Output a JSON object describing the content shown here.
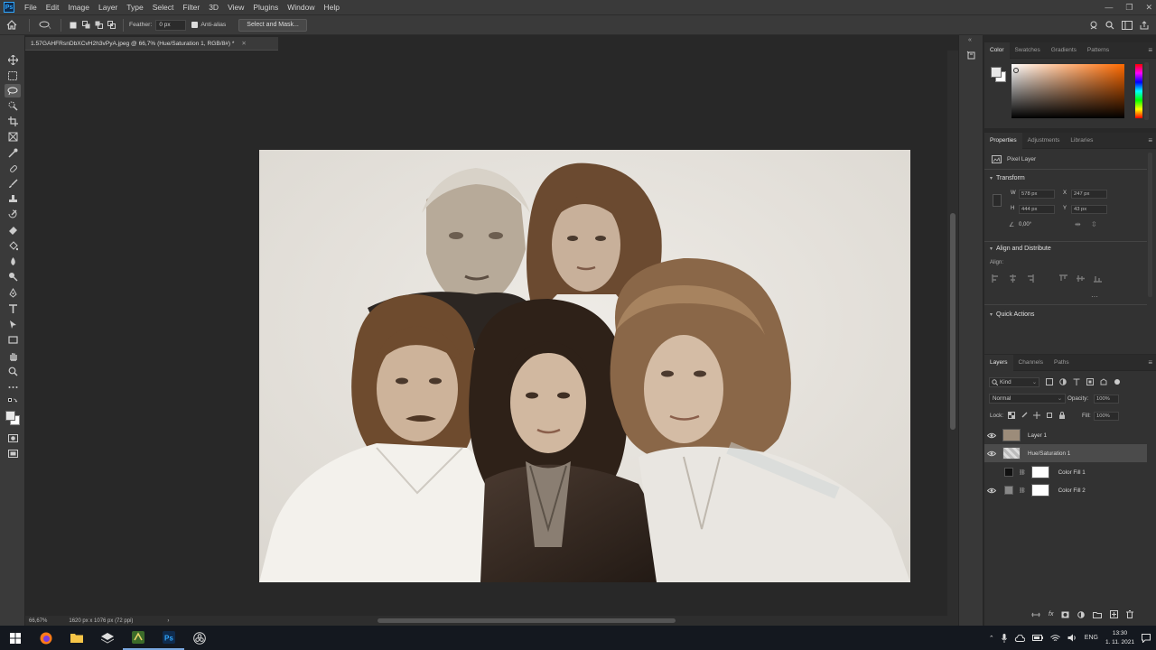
{
  "app": {
    "logo_text": "Ps"
  },
  "menubar": {
    "items": [
      "File",
      "Edit",
      "Image",
      "Layer",
      "Type",
      "Select",
      "Filter",
      "3D",
      "View",
      "Plugins",
      "Window",
      "Help"
    ]
  },
  "options_bar": {
    "feather_label": "Feather:",
    "feather_value": "0 px",
    "antialias_label": "Anti-alias",
    "select_mask_label": "Select and Mask..."
  },
  "document": {
    "tab_title": "1.57GAHFRsnDbXCvH2h3vPyA.jpeg @ 66,7% (Hue/Saturation 1, RGB/8#) *",
    "zoom": "66,67%",
    "doc_info": "1620 px x 1076 px (72 ppi)"
  },
  "color_panel": {
    "tabs": [
      "Color",
      "Swatches",
      "Gradients",
      "Patterns"
    ],
    "active_tab": "Color"
  },
  "properties_panel": {
    "tabs": [
      "Properties",
      "Adjustments",
      "Libraries"
    ],
    "active_tab": "Properties",
    "layer_kind": "Pixel Layer",
    "transform_label": "Transform",
    "w_label": "W",
    "w_value": "578 px",
    "h_label": "H",
    "h_value": "444 px",
    "x_label": "X",
    "x_value": "247 px",
    "y_label": "Y",
    "y_value": "43 px",
    "angle_value": "0,00°",
    "align_label": "Align and Distribute",
    "align_sub": "Align:",
    "quick_actions_label": "Quick Actions"
  },
  "layers_panel": {
    "tabs": [
      "Layers",
      "Channels",
      "Paths"
    ],
    "active_tab": "Layers",
    "filter_kind": "Kind",
    "blend_mode": "Normal",
    "opacity_label": "Opacity:",
    "opacity_value": "100%",
    "lock_label": "Lock:",
    "fill_label": "Fill:",
    "fill_value": "100%",
    "layers": [
      {
        "name": "Layer 1",
        "visible": true,
        "selected": false
      },
      {
        "name": "Hue/Saturation 1",
        "visible": true,
        "selected": true
      },
      {
        "name": "Color Fill 1",
        "visible": false,
        "selected": false
      },
      {
        "name": "Color Fill 2",
        "visible": true,
        "selected": false
      }
    ]
  },
  "taskbar": {
    "lang": "ENG",
    "time": "13:30",
    "date": "1. 11. 2021"
  },
  "colors": {
    "ps_blue": "#31a8ff",
    "panel_bg": "#323232",
    "app_bg": "#282828"
  }
}
